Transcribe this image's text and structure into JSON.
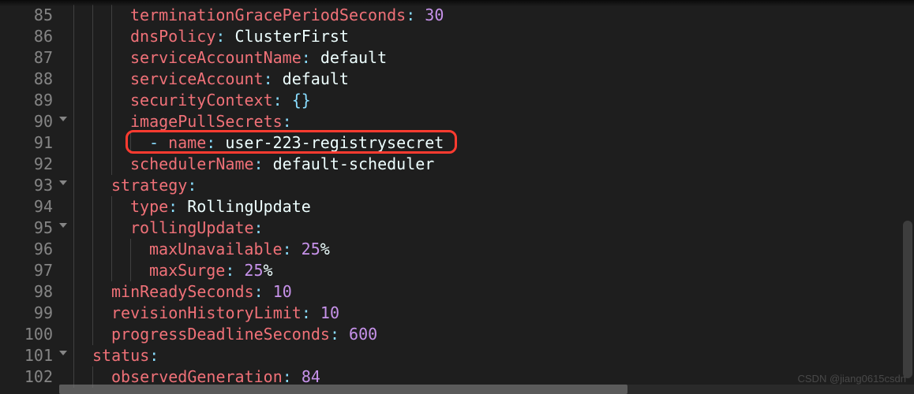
{
  "watermark": "CSDN @jiang0615csdn",
  "lines": [
    {
      "num": 85,
      "fold": false,
      "indent": 3,
      "segs": [
        {
          "cls": "tk-key",
          "t": "terminationGracePeriodSeconds"
        },
        {
          "cls": "tk-punc",
          "t": ":"
        },
        {
          "cls": "tk-white",
          "t": " "
        },
        {
          "cls": "tk-num",
          "t": "30"
        }
      ]
    },
    {
      "num": 86,
      "fold": false,
      "indent": 3,
      "segs": [
        {
          "cls": "tk-key",
          "t": "dnsPolicy"
        },
        {
          "cls": "tk-punc",
          "t": ":"
        },
        {
          "cls": "tk-white",
          "t": " ClusterFirst"
        }
      ]
    },
    {
      "num": 87,
      "fold": false,
      "indent": 3,
      "segs": [
        {
          "cls": "tk-key",
          "t": "serviceAccountName"
        },
        {
          "cls": "tk-punc",
          "t": ":"
        },
        {
          "cls": "tk-white",
          "t": " default"
        }
      ]
    },
    {
      "num": 88,
      "fold": false,
      "indent": 3,
      "segs": [
        {
          "cls": "tk-key",
          "t": "serviceAccount"
        },
        {
          "cls": "tk-punc",
          "t": ":"
        },
        {
          "cls": "tk-white",
          "t": " default"
        }
      ]
    },
    {
      "num": 89,
      "fold": false,
      "indent": 3,
      "segs": [
        {
          "cls": "tk-key",
          "t": "securityContext"
        },
        {
          "cls": "tk-punc",
          "t": ":"
        },
        {
          "cls": "tk-white",
          "t": " "
        },
        {
          "cls": "tk-punc",
          "t": "{}"
        }
      ]
    },
    {
      "num": 90,
      "fold": true,
      "indent": 3,
      "segs": [
        {
          "cls": "tk-key",
          "t": "imagePullSecrets"
        },
        {
          "cls": "tk-punc",
          "t": ":"
        }
      ]
    },
    {
      "num": 91,
      "fold": false,
      "indent": 4,
      "segs": [
        {
          "cls": "tk-dash",
          "t": "- "
        },
        {
          "cls": "tk-key",
          "t": "name"
        },
        {
          "cls": "tk-punc",
          "t": ":"
        },
        {
          "cls": "tk-white",
          "t": " user-223-registrysecret"
        }
      ],
      "highlight": true
    },
    {
      "num": 92,
      "fold": false,
      "indent": 3,
      "segs": [
        {
          "cls": "tk-key",
          "t": "schedulerName"
        },
        {
          "cls": "tk-punc",
          "t": ":"
        },
        {
          "cls": "tk-white",
          "t": " default-scheduler"
        }
      ]
    },
    {
      "num": 93,
      "fold": true,
      "indent": 2,
      "segs": [
        {
          "cls": "tk-key",
          "t": "strategy"
        },
        {
          "cls": "tk-punc",
          "t": ":"
        }
      ]
    },
    {
      "num": 94,
      "fold": false,
      "indent": 3,
      "segs": [
        {
          "cls": "tk-key",
          "t": "type"
        },
        {
          "cls": "tk-punc",
          "t": ":"
        },
        {
          "cls": "tk-white",
          "t": " RollingUpdate"
        }
      ]
    },
    {
      "num": 95,
      "fold": true,
      "indent": 3,
      "segs": [
        {
          "cls": "tk-key",
          "t": "rollingUpdate"
        },
        {
          "cls": "tk-punc",
          "t": ":"
        }
      ]
    },
    {
      "num": 96,
      "fold": false,
      "indent": 4,
      "segs": [
        {
          "cls": "tk-key",
          "t": "maxUnavailable"
        },
        {
          "cls": "tk-punc",
          "t": ":"
        },
        {
          "cls": "tk-white",
          "t": " "
        },
        {
          "cls": "tk-num",
          "t": "25"
        },
        {
          "cls": "tk-white",
          "t": "%"
        }
      ]
    },
    {
      "num": 97,
      "fold": false,
      "indent": 4,
      "segs": [
        {
          "cls": "tk-key",
          "t": "maxSurge"
        },
        {
          "cls": "tk-punc",
          "t": ":"
        },
        {
          "cls": "tk-white",
          "t": " "
        },
        {
          "cls": "tk-num",
          "t": "25"
        },
        {
          "cls": "tk-white",
          "t": "%"
        }
      ]
    },
    {
      "num": 98,
      "fold": false,
      "indent": 2,
      "segs": [
        {
          "cls": "tk-key",
          "t": "minReadySeconds"
        },
        {
          "cls": "tk-punc",
          "t": ":"
        },
        {
          "cls": "tk-white",
          "t": " "
        },
        {
          "cls": "tk-num",
          "t": "10"
        }
      ]
    },
    {
      "num": 99,
      "fold": false,
      "indent": 2,
      "segs": [
        {
          "cls": "tk-key",
          "t": "revisionHistoryLimit"
        },
        {
          "cls": "tk-punc",
          "t": ":"
        },
        {
          "cls": "tk-white",
          "t": " "
        },
        {
          "cls": "tk-num",
          "t": "10"
        }
      ]
    },
    {
      "num": 100,
      "fold": false,
      "indent": 2,
      "segs": [
        {
          "cls": "tk-key",
          "t": "progressDeadlineSeconds"
        },
        {
          "cls": "tk-punc",
          "t": ":"
        },
        {
          "cls": "tk-white",
          "t": " "
        },
        {
          "cls": "tk-num",
          "t": "600"
        }
      ]
    },
    {
      "num": 101,
      "fold": true,
      "indent": 1,
      "segs": [
        {
          "cls": "tk-key",
          "t": "status"
        },
        {
          "cls": "tk-punc",
          "t": ":"
        }
      ]
    },
    {
      "num": 102,
      "fold": false,
      "indent": 2,
      "segs": [
        {
          "cls": "tk-key",
          "t": "observedGeneration"
        },
        {
          "cls": "tk-punc",
          "t": ":"
        },
        {
          "cls": "tk-white",
          "t": " "
        },
        {
          "cls": "tk-num",
          "t": "84"
        }
      ]
    }
  ]
}
